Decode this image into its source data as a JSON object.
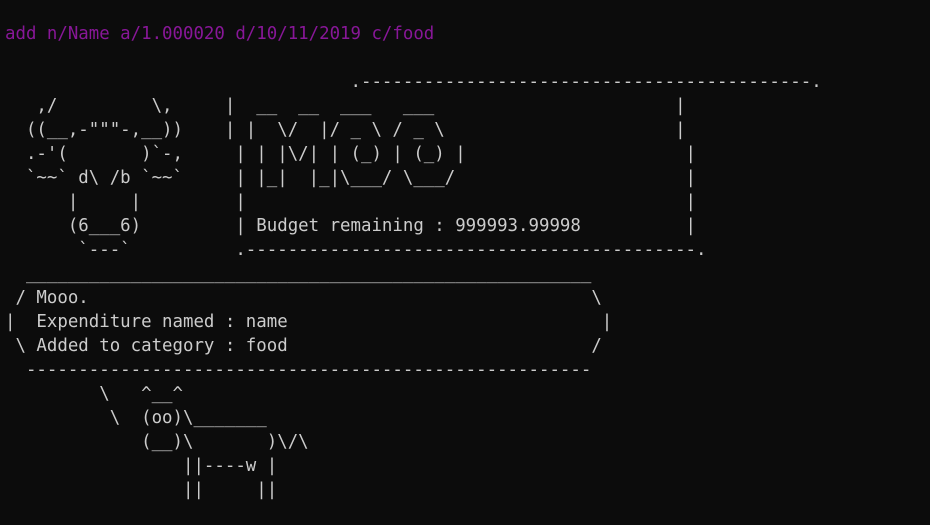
{
  "terminal": {
    "command": "add n/Name a/1.000020 d/10/11/2019 c/food",
    "colors": {
      "background": "#0c0c0c",
      "text": "#cccccc",
      "command": "#881798"
    },
    "banner_lines": [
      "                                 .-------------------------------------------.",
      "   ,/         \\,     |  __  __  ___   ___                       |",
      "  ((__,-\"\"\"-,__))    | |  \\/  |/ _ \\ / _ \\                      |",
      "  .-'(       )`-,     | | |\\/| | (_) | (_) |                     |",
      "  `~~` d\\ /b `~~`     | |_|  |_|\\___/ \\___/                      |",
      "      |     |         |                                          |",
      "      (6___6)         | Budget remaining : 999993.99998          |",
      "       `---`          .-------------------------------------------."
    ],
    "speech_lines": [
      "  ______________________________________________________",
      " / Mooo.                                                \\",
      "|  Expenditure named : name                              |",
      " \\ Added to category : food                             /",
      "  ------------------------------------------------------"
    ],
    "cow_lines": [
      "         \\   ^__^",
      "          \\  (oo)\\_______",
      "             (__)\\       )\\/\\",
      "                 ||----w |",
      "                 ||     ||"
    ]
  }
}
